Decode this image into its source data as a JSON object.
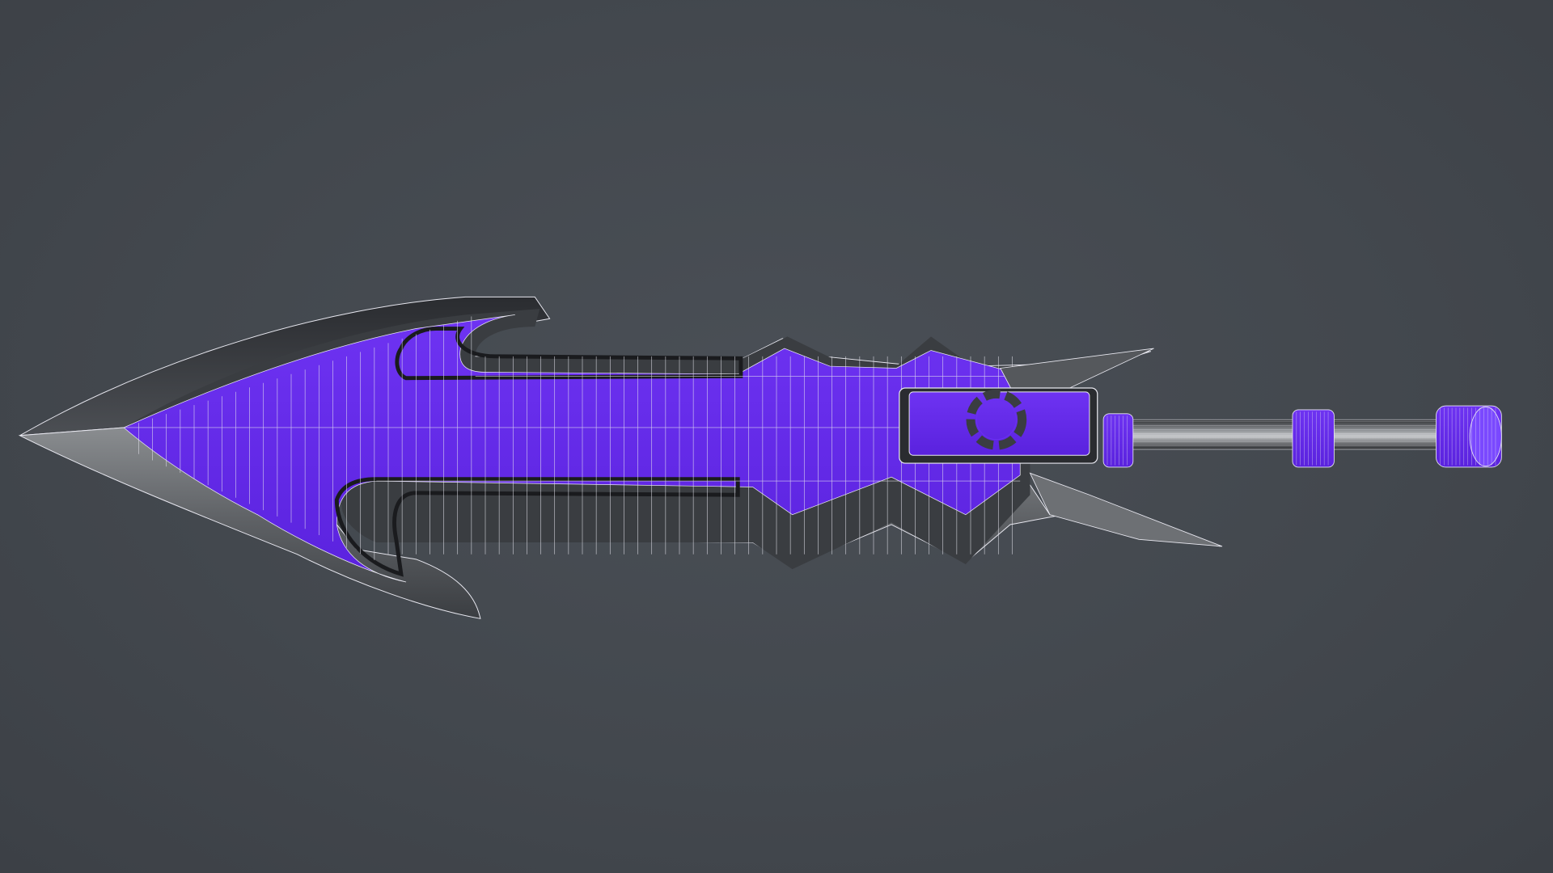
{
  "scene": {
    "background_color": "#42474d",
    "blade_accent_color": "#6a2ff0",
    "metal_color": "#6f7275",
    "edge_dark_color": "#1f2124",
    "wireframe_color": "#e8e8f0",
    "object": "sword-3d-wireframe-render",
    "components": [
      "blade",
      "blade-fuller",
      "hooks",
      "guard-plate",
      "emblem-ring",
      "grip",
      "grip-rings",
      "pommel"
    ]
  }
}
